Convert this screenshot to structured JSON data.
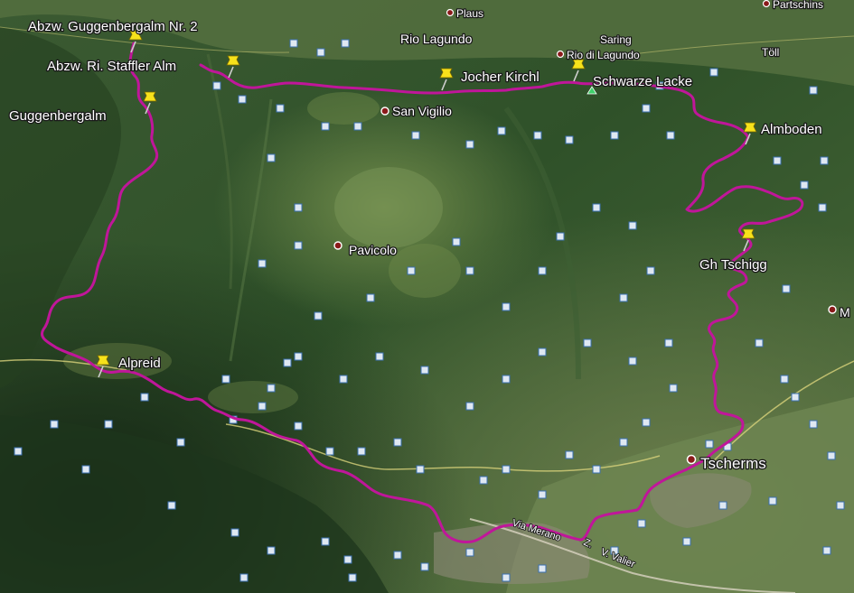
{
  "route_color": "#c0169a",
  "pin_color": "#f7e21b",
  "place_dot_color": "#8a1a1a",
  "waypoints": [
    {
      "name": "Abzw. Guggenbergalm Nr. 2"
    },
    {
      "name": "Abzw. Ri. Staffler Alm"
    },
    {
      "name": "Guggenbergalm"
    },
    {
      "name": "Jocher Kirchl"
    },
    {
      "name": "Schwarze Lacke"
    },
    {
      "name": "Almboden"
    },
    {
      "name": "Gh Tschigg"
    },
    {
      "name": "Alpreid"
    }
  ],
  "places": {
    "plaus": "Plaus",
    "rio_lagundo": "Rio Lagundo",
    "saring": "Saring",
    "rio_di_lagundo": "Rio di Lagundo",
    "partschins": "Partschins",
    "toll": "Töll",
    "san_vigilio": "San Vigilio",
    "pavicolo": "Pavicolo",
    "tscherms": "Tscherms",
    "m_partial": "M"
  },
  "roads": {
    "via_merano": "Via Merano",
    "via_valier": "V. Valier",
    "via_valier_prefix": "Z."
  }
}
